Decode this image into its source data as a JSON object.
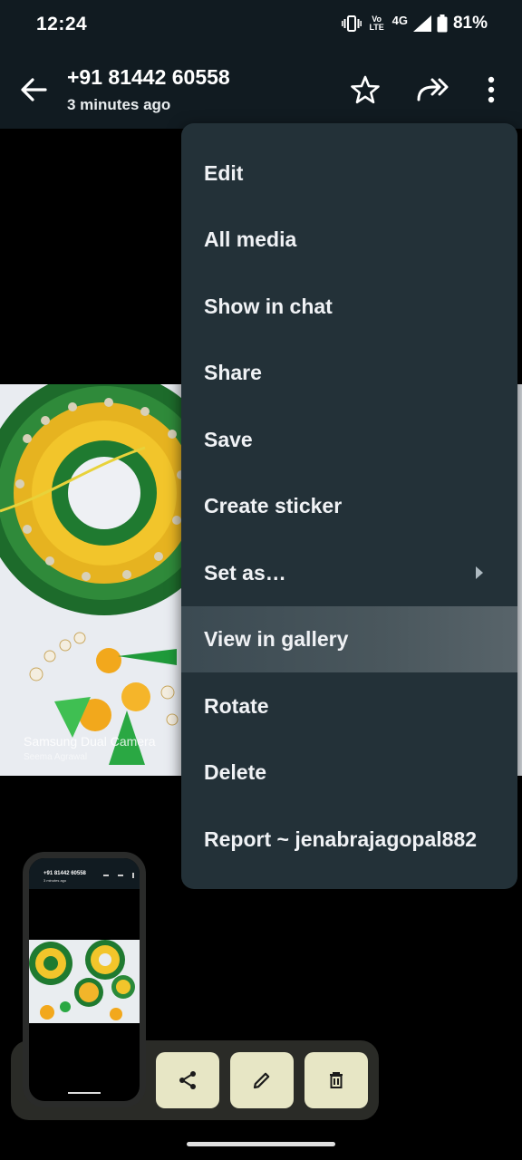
{
  "status": {
    "time": "12:24",
    "volte": "Vo LTE",
    "network": "4G",
    "battery": "81%"
  },
  "header": {
    "title": "+91 81442 60558",
    "subtitle": "3 minutes ago"
  },
  "photo": {
    "watermark": "Samsung Dual Camera",
    "watermark_sub": "Seema Agrawal"
  },
  "menu": {
    "items": [
      {
        "label": "Edit"
      },
      {
        "label": "All media"
      },
      {
        "label": "Show in chat"
      },
      {
        "label": "Share"
      },
      {
        "label": "Save"
      },
      {
        "label": "Create sticker"
      },
      {
        "label": "Set as…",
        "has_submenu": true
      },
      {
        "label": "View in gallery",
        "highlighted": true
      },
      {
        "label": "Rotate"
      },
      {
        "label": "Delete"
      },
      {
        "label": "Report ~ jenabrajagopal882"
      }
    ]
  },
  "thumbnail": {
    "title": "+91 81442 60558",
    "subtitle": "3 minutes ago"
  },
  "actions": [
    {
      "icon": "share-icon"
    },
    {
      "icon": "pencil-icon"
    },
    {
      "icon": "trash-icon"
    }
  ],
  "colors": {
    "menu_bg": "#233138",
    "appbar_bg": "#111b21",
    "action_button": "#e7e6c5",
    "highlight": "#4a575d"
  }
}
